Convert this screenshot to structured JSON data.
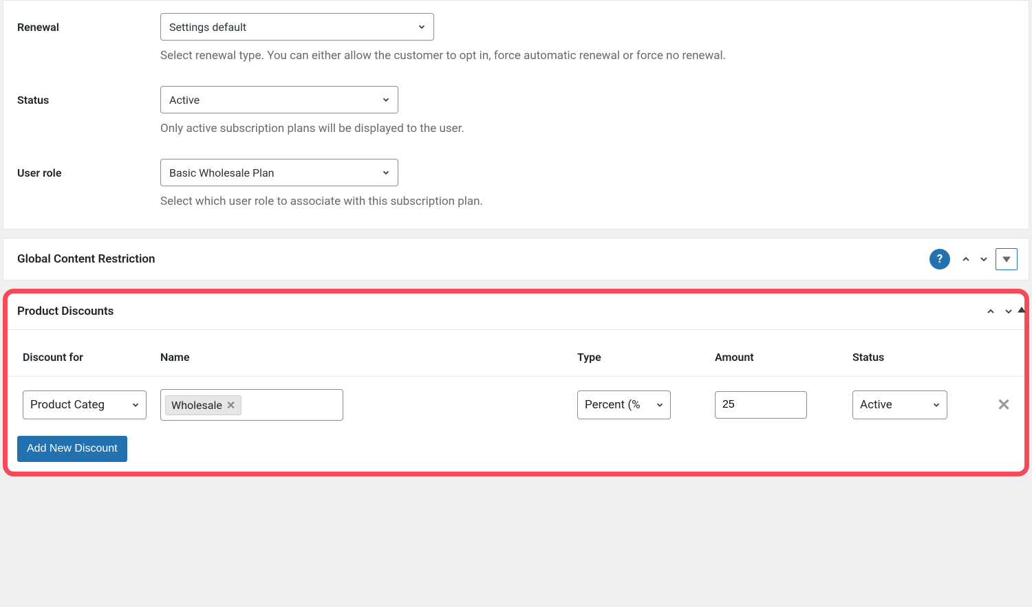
{
  "settings": {
    "renewal": {
      "label": "Renewal",
      "value": "Settings default",
      "help": "Select renewal type. You can either allow the customer to opt in, force automatic renewal or force no renewal."
    },
    "status": {
      "label": "Status",
      "value": "Active",
      "help": "Only active subscription plans will be displayed to the user."
    },
    "user_role": {
      "label": "User role",
      "value": "Basic Wholesale Plan",
      "help": "Select which user role to associate with this subscription plan."
    }
  },
  "gcr": {
    "title": "Global Content Restriction"
  },
  "pd": {
    "title": "Product Discounts",
    "columns": {
      "for": "Discount for",
      "name": "Name",
      "type": "Type",
      "amount": "Amount",
      "status": "Status"
    },
    "row": {
      "for": "Product Categ",
      "tag": "Wholesale",
      "type": "Percent (%",
      "amount": "25",
      "status": "Active"
    },
    "add_label": "Add New Discount"
  }
}
